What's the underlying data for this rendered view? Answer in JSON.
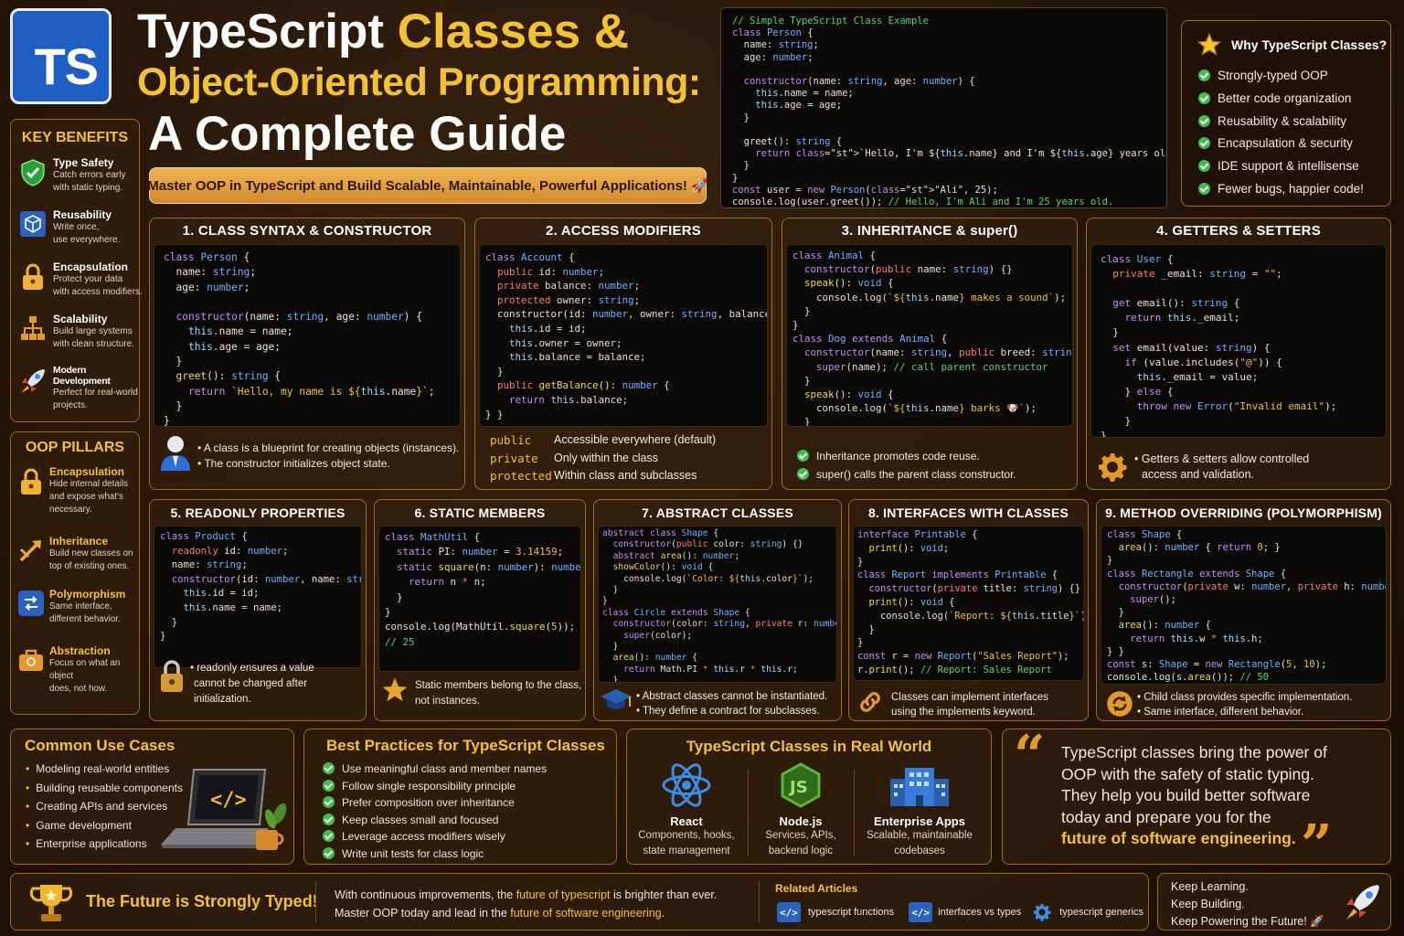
{
  "logo": "TS",
  "title": {
    "line1_white": "TypeScript ",
    "line1_gold": "Classes &",
    "line2": "Object-Oriented Programming:",
    "line3": "A Complete Guide"
  },
  "banner": "Master OOP in TypeScript and Build Scalable, Maintainable, Powerful Applications! 🚀",
  "key_benefits": {
    "heading": "KEY BENEFITS",
    "items": [
      {
        "title": "Type Safety",
        "desc1": "Catch errors early",
        "desc2": "with static typing.",
        "icon": "shield-check-icon"
      },
      {
        "title": "Reusability",
        "desc1": "Write once,",
        "desc2": "use everywhere.",
        "icon": "cube-icon"
      },
      {
        "title": "Encapsulation",
        "desc1": "Protect your data",
        "desc2": "with access modifiers.",
        "icon": "lock-icon"
      },
      {
        "title": "Scalability",
        "desc1": "Build large systems",
        "desc2": "with clean structure.",
        "icon": "hierarchy-icon"
      },
      {
        "title": "Modern Development",
        "desc1": "Perfect for real-world",
        "desc2": "projects.",
        "icon": "rocket-icon"
      }
    ]
  },
  "oop_pillars": {
    "heading": "OOP PILLARS",
    "items": [
      {
        "title": "Encapsulation",
        "desc1": "Hide internal details",
        "desc2": "and expose what's",
        "desc3": "necessary.",
        "icon": "lock-icon"
      },
      {
        "title": "Inheritance",
        "desc1": "Build new classes on",
        "desc2": "top of existing ones.",
        "desc3": "",
        "icon": "arrows-icon"
      },
      {
        "title": "Polymorphism",
        "desc1": "Same interface,",
        "desc2": "different behavior.",
        "desc3": "",
        "icon": "switch-icon"
      },
      {
        "title": "Abstraction",
        "desc1": "Focus on what an object",
        "desc2": "does, not how.",
        "desc3": "",
        "icon": "briefcase-icon"
      }
    ]
  },
  "top_code": [
    "// Simple TypeScript Class Example",
    "class Person {",
    "  name: string;",
    "  age: number;",
    "",
    "  constructor(name: string, age: number) {",
    "    this.name = name;",
    "    this.age = age;",
    "  }",
    "",
    "  greet(): string {",
    "    return `Hello, I'm ${this.name} and I'm ${this.age} years old.`;",
    "  }",
    "}",
    "const user = new Person(\"Ali\", 25);",
    "console.log(user.greet()); // Hello, I'm Ali and I'm 25 years old."
  ],
  "why": {
    "heading": "Why TypeScript Classes?",
    "items": [
      "Strongly-typed OOP",
      "Better code organization",
      "Reusability & scalability",
      "Encapsulation & security",
      "IDE support & intellisense",
      "Fewer bugs, happier code!"
    ]
  },
  "sections": {
    "s1": {
      "title": "1. CLASS SYNTAX & CONSTRUCTOR",
      "foot1": "• A class is a blueprint for creating objects (instances).",
      "foot2": "• The constructor initializes object state."
    },
    "s2": {
      "title": "2. ACCESS MODIFIERS",
      "rows": [
        {
          "kw": "public",
          "desc": "Accessible everywhere (default)"
        },
        {
          "kw": "private",
          "desc": "Only within the class"
        },
        {
          "kw": "protected",
          "desc": "Within class and subclasses"
        }
      ]
    },
    "s3": {
      "title": "3. INHERITANCE & super()",
      "foot1": "Inheritance promotes code reuse.",
      "foot2": "super() calls the parent class constructor."
    },
    "s4": {
      "title": "4. GETTERS & SETTERS",
      "foot1": "• Getters & setters allow controlled",
      "foot2": "access and validation."
    },
    "s5": {
      "title": "5. READONLY PROPERTIES",
      "foot1": "• readonly ensures a value",
      "foot2": "cannot be changed after initialization."
    },
    "s6": {
      "title": "6. STATIC MEMBERS",
      "foot1": "Static members belong to the class,",
      "foot2": "not instances."
    },
    "s7": {
      "title": "7. ABSTRACT CLASSES",
      "foot1": "• Abstract classes cannot be instantiated.",
      "foot2": "• They define a contract for subclasses."
    },
    "s8": {
      "title": "8. INTERFACES WITH CLASSES",
      "foot1": "Classes can implement interfaces",
      "foot2": "using the implements keyword."
    },
    "s9": {
      "title": "9. METHOD OVERRIDING (POLYMORPHISM)",
      "foot1": "• Child class provides specific implementation.",
      "foot2": "• Same interface, different behavior."
    }
  },
  "use_cases": {
    "heading": "Common Use Cases",
    "items": [
      "Modeling real-world entities",
      "Building reusable components",
      "Creating APIs and services",
      "Game development",
      "Enterprise applications"
    ]
  },
  "best_practices": {
    "heading": "Best Practices for TypeScript Classes",
    "items": [
      "Use meaningful class and member names",
      "Follow single responsibility principle",
      "Prefer composition over inheritance",
      "Keep classes small and focused",
      "Leverage access modifiers wisely",
      "Write unit tests for class logic"
    ]
  },
  "real_world": {
    "heading": "TypeScript Classes in Real World",
    "items": [
      {
        "title": "React",
        "desc1": "Components, hooks,",
        "desc2": "state management",
        "icon": "react-atom-icon"
      },
      {
        "title": "Node.js",
        "desc1": "Services, APIs,",
        "desc2": "backend logic",
        "icon": "nodejs-hex-icon"
      },
      {
        "title": "Enterprise Apps",
        "desc1": "Scalable, maintainable",
        "desc2": "codebases",
        "icon": "building-icon"
      }
    ]
  },
  "quote": {
    "line1": "TypeScript classes bring the power of",
    "line2": "OOP with the safety of static typing.",
    "line3": "They help you build better software",
    "line4": "today and prepare you for the",
    "line5": "future of software engineering."
  },
  "future": {
    "heading": "The Future is Strongly Typed!",
    "text1_a": "With continuous improvements, the ",
    "text1_b": "future of typescript",
    "text1_c": " is brighter than ever.",
    "text2_a": "Master OOP today and lead in the ",
    "text2_b": "future of software engineering",
    "text2_c": "."
  },
  "related": {
    "heading": "Related Articles",
    "items": [
      "typescript functions",
      "interfaces vs types",
      "typescript generics"
    ]
  },
  "keep": {
    "line1": "Keep Learning.",
    "line2": "Keep Building.",
    "line3": "Keep Powering the Future! 🚀"
  },
  "colors": {
    "gold": "#f2c234",
    "border": "#9c6a2a",
    "ts_blue": "#1e63c7",
    "check_green": "#3fbf4a"
  }
}
